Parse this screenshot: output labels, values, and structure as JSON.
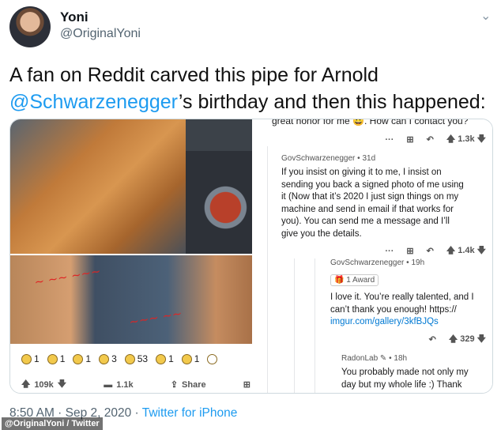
{
  "user": {
    "name": "Yoni",
    "handle": "@OriginalYoni"
  },
  "tweet": {
    "text_pre": "A fan on Reddit carved this pipe for Arnold ",
    "mention": "@Schwarzenegger",
    "text_post": "’s birthday and then this happened:",
    "time": "8:50 AM · Sep 2, 2020 · ",
    "source": "Twitter for iPhone"
  },
  "reddit_post": {
    "awards": [
      "1",
      "1",
      "1",
      "3",
      "53",
      "1",
      "1"
    ],
    "upvotes": "109k",
    "comments": "1.1k",
    "share": "Share"
  },
  "thread": {
    "cut_text": "great honor for me 😀. How can I contact you?",
    "cut_score": "1.3k",
    "c1": {
      "author": "GovSchwarzenegger",
      "age": " • 31d",
      "lines": [
        "If you insist on giving it to me, I insist on",
        "sending you back a signed photo of me using",
        "it (Now that it’s 2020 I just sign things on my",
        "machine and send in email if that works for",
        "you). You can send me a message and I’ll",
        "give you the details."
      ],
      "score": "1.4k"
    },
    "c2": {
      "author": "GovSchwarzenegger",
      "age": " • 19h",
      "award": "1 Award",
      "lines": [
        "I love it. You’re really talented, and I",
        "can’t thank you enough! https://"
      ],
      "link": "imgur.com/gallery/3kfBJQs",
      "score": "329"
    },
    "c3": {
      "author": "RadonLab",
      "age": " • 18h",
      "lines": [
        "You probably made not only my",
        "day but my whole life :) Thank"
      ]
    }
  },
  "credit": "@OriginalYoni / Twitter",
  "colors": {
    "link": "#1d9bf0",
    "reddit_link": "#0079d3",
    "signature": "#e02424"
  }
}
